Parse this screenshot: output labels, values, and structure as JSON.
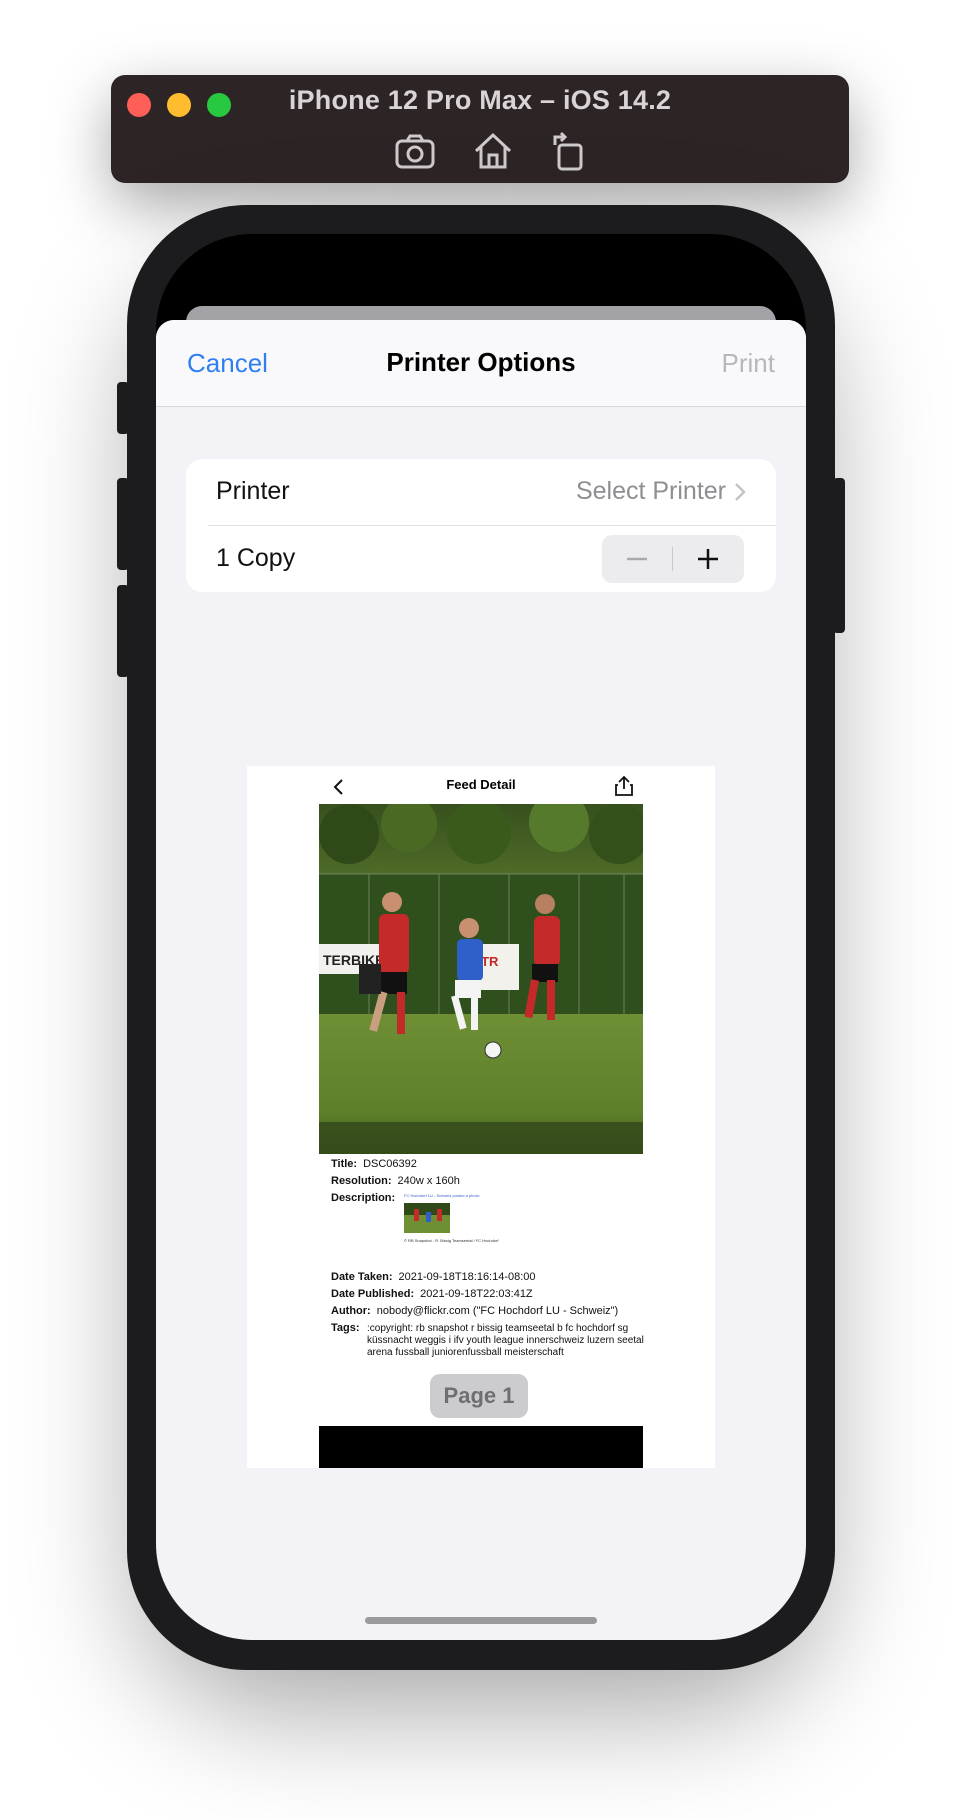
{
  "simulator": {
    "title": "iPhone 12 Pro Max – iOS 14.2",
    "tools": [
      "camera-icon",
      "home-icon",
      "rotate-icon"
    ]
  },
  "navbar": {
    "cancel": "Cancel",
    "title": "Printer Options",
    "print": "Print"
  },
  "options": {
    "printer_label": "Printer",
    "printer_value": "Select Printer",
    "copies_label": "1 Copy",
    "copies": 1
  },
  "preview": {
    "header_title": "Feed Detail",
    "fields": {
      "title_label": "Title:",
      "title_value": "DSC06392",
      "resolution_label": "Resolution:",
      "resolution_value": "240w x 160h",
      "description_label": "Description:",
      "description_link": "FC Hochdorf LU - Schweiz posted a photo:",
      "description_caption": "© RB Snapshot - R. Bissig Teamseetal / FC Hochdorf",
      "date_taken_label": "Date Taken:",
      "date_taken_value": "2021-09-18T18:16:14-08:00",
      "date_published_label": "Date Published:",
      "date_published_value": "2021-09-18T22:03:41Z",
      "author_label": "Author:",
      "author_value": "nobody@flickr.com (\"FC Hochdorf LU - Schweiz\")",
      "tags_label": "Tags:",
      "tags_value": ":copyright: rb snapshot r bissig teamseetal b fc hochdorf sg küssnacht weggis i ifv youth league innerschweiz luzern seetal arena fussball juniorenfussball meisterschaft"
    },
    "page_badge": "Page 1"
  },
  "colors": {
    "accent": "#2f7ff2",
    "disabled": "#b8b8bc",
    "sheet_bg": "#f2f2f7"
  }
}
